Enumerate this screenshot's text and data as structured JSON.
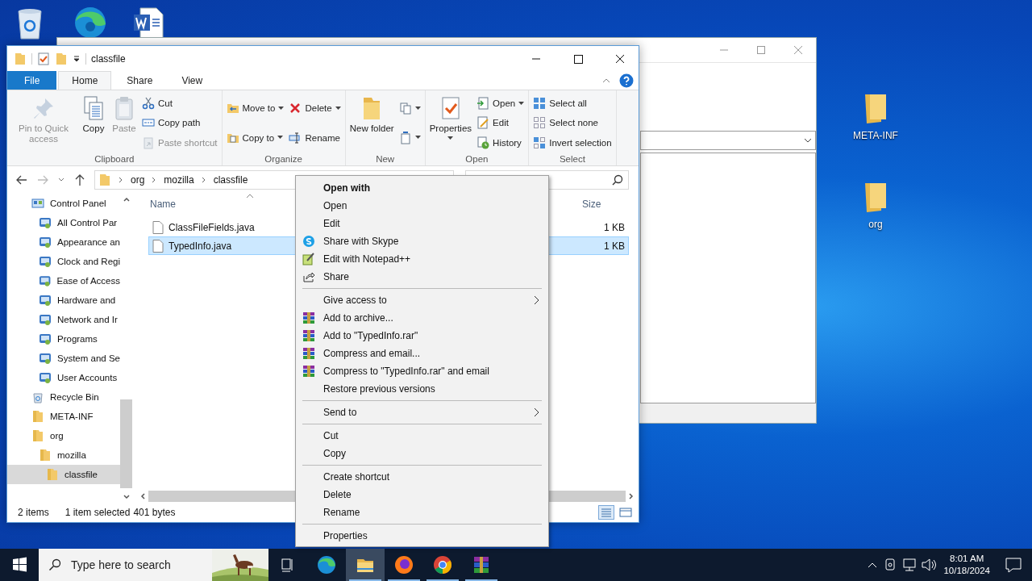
{
  "desktop_shortcuts": [
    {
      "label": "META-INF"
    },
    {
      "label": "org"
    }
  ],
  "explorer": {
    "title": "classfile",
    "tabs": [
      {
        "label": "File",
        "kind": "file",
        "selected": false
      },
      {
        "label": "Home",
        "kind": "tab",
        "selected": true
      },
      {
        "label": "Share",
        "kind": "tab",
        "selected": false
      },
      {
        "label": "View",
        "kind": "tab",
        "selected": false
      }
    ],
    "ribbon": [
      {
        "label": "Clipboard",
        "columns": [
          {
            "kind": "large",
            "items": [
              {
                "label": "Pin to Quick access",
                "disabled": true,
                "dropdown": false
              }
            ]
          },
          {
            "kind": "large",
            "items": [
              {
                "label": "Copy",
                "disabled": false,
                "dropdown": false
              }
            ]
          },
          {
            "kind": "large",
            "items": [
              {
                "label": "Paste",
                "disabled": true,
                "dropdown": false
              }
            ]
          },
          {
            "kind": "small",
            "items": [
              {
                "label": "Cut",
                "disabled": false,
                "dropdown": false
              },
              {
                "label": "Copy path",
                "disabled": false,
                "dropdown": false
              },
              {
                "label": "Paste shortcut",
                "disabled": true,
                "dropdown": false
              }
            ]
          }
        ]
      },
      {
        "label": "Organize",
        "columns": [
          {
            "kind": "small",
            "items": [
              {
                "label": "Move to",
                "disabled": false,
                "dropdown": true
              },
              {
                "label": "Copy to",
                "disabled": false,
                "dropdown": true
              }
            ]
          },
          {
            "kind": "small",
            "items": [
              {
                "label": "Delete",
                "disabled": false,
                "dropdown": true
              },
              {
                "label": "Rename",
                "disabled": false,
                "dropdown": false
              }
            ]
          }
        ]
      },
      {
        "label": "New",
        "columns": [
          {
            "kind": "large",
            "items": [
              {
                "label": "New folder",
                "disabled": false,
                "dropdown": false
              }
            ]
          },
          {
            "kind": "small",
            "items": [
              {
                "disabled": false,
                "dropdown": true
              },
              {
                "disabled": false,
                "dropdown": true
              }
            ]
          }
        ]
      },
      {
        "label": "Open",
        "columns": [
          {
            "kind": "large",
            "items": [
              {
                "label": "Properties",
                "disabled": false,
                "dropdown": true
              }
            ]
          },
          {
            "kind": "small",
            "items": [
              {
                "label": "Open",
                "disabled": false,
                "dropdown": true
              },
              {
                "label": "Edit",
                "disabled": false,
                "dropdown": false
              },
              {
                "label": "History",
                "disabled": false,
                "dropdown": false
              }
            ]
          }
        ]
      },
      {
        "label": "Select",
        "columns": [
          {
            "kind": "small",
            "items": [
              {
                "label": "Select all",
                "disabled": false,
                "dropdown": false
              },
              {
                "label": "Select none",
                "disabled": false,
                "dropdown": false
              },
              {
                "label": "Invert selection",
                "disabled": false,
                "dropdown": false
              }
            ]
          }
        ]
      }
    ],
    "address": {
      "path": [
        "org",
        "mozilla",
        "classfile"
      ]
    },
    "nav": [
      {
        "label": "Control Panel",
        "kind": "control-panel",
        "selected": false,
        "children": [
          {
            "label": "All Control Par",
            "kind": "applet",
            "selected": false
          },
          {
            "label": "Appearance an",
            "kind": "applet",
            "selected": false
          },
          {
            "label": "Clock and Regi",
            "kind": "applet",
            "selected": false
          },
          {
            "label": "Ease of Access",
            "kind": "applet",
            "selected": false
          },
          {
            "label": "Hardware and",
            "kind": "applet",
            "selected": false
          },
          {
            "label": "Network and Ir",
            "kind": "applet",
            "selected": false
          },
          {
            "label": "Programs",
            "kind": "applet",
            "selected": false
          },
          {
            "label": "System and Se",
            "kind": "applet",
            "selected": false
          },
          {
            "label": "User Accounts",
            "kind": "applet",
            "selected": false
          }
        ]
      },
      {
        "label": "Recycle Bin",
        "kind": "recycle-bin",
        "selected": false
      },
      {
        "label": "META-INF",
        "kind": "folder",
        "selected": false
      },
      {
        "label": "org",
        "kind": "folder",
        "selected": false,
        "children": [
          {
            "label": "mozilla",
            "kind": "folder",
            "selected": false,
            "children": [
              {
                "label": "classfile",
                "kind": "folder",
                "selected": true
              }
            ]
          }
        ]
      }
    ],
    "list": {
      "columns": [
        "Name",
        "Size"
      ],
      "files": [
        {
          "name": "ClassFileFields.java",
          "size": "1 KB",
          "selected": false
        },
        {
          "name": "TypedInfo.java",
          "size": "1 KB",
          "selected": true
        }
      ]
    },
    "status": {
      "count": "2 items",
      "selection": "1 item selected",
      "size": "401 bytes",
      "views": [
        {
          "kind": "details",
          "selected": true
        },
        {
          "kind": "icons",
          "selected": false
        }
      ]
    }
  },
  "context_menu": {
    "items": [
      {
        "label": "Open with",
        "kind": "default",
        "submenu": false
      },
      {
        "label": "Open",
        "kind": "item",
        "submenu": false
      },
      {
        "label": "Edit",
        "kind": "item",
        "submenu": false
      },
      {
        "label": "Share with Skype",
        "kind": "item",
        "submenu": false
      },
      {
        "label": "Edit with Notepad++",
        "kind": "item",
        "submenu": false
      },
      {
        "label": "Share",
        "kind": "item",
        "submenu": false
      },
      {
        "kind": "separator"
      },
      {
        "label": "Give access to",
        "kind": "item",
        "submenu": true
      },
      {
        "label": "Add to archive...",
        "kind": "item",
        "submenu": false
      },
      {
        "label": "Add to \"TypedInfo.rar\"",
        "kind": "item",
        "submenu": false
      },
      {
        "label": "Compress and email...",
        "kind": "item",
        "submenu": false
      },
      {
        "label": "Compress to \"TypedInfo.rar\" and email",
        "kind": "item",
        "submenu": false
      },
      {
        "label": "Restore previous versions",
        "kind": "item",
        "submenu": false
      },
      {
        "kind": "separator"
      },
      {
        "label": "Send to",
        "kind": "item",
        "submenu": true
      },
      {
        "kind": "separator"
      },
      {
        "label": "Cut",
        "kind": "item",
        "submenu": false
      },
      {
        "label": "Copy",
        "kind": "item",
        "submenu": false
      },
      {
        "kind": "separator"
      },
      {
        "label": "Create shortcut",
        "kind": "item",
        "submenu": false
      },
      {
        "label": "Delete",
        "kind": "item",
        "submenu": false
      },
      {
        "label": "Rename",
        "kind": "item",
        "submenu": false
      },
      {
        "kind": "separator"
      },
      {
        "label": "Properties",
        "kind": "item",
        "submenu": false
      }
    ]
  },
  "taskbar": {
    "search_placeholder": "Type here to search",
    "apps": [
      {
        "kind": "edge",
        "selected": false,
        "running": false
      },
      {
        "kind": "explorer",
        "selected": true,
        "running": true
      },
      {
        "kind": "firefox",
        "selected": false,
        "running": true
      },
      {
        "kind": "chrome",
        "selected": false,
        "running": true
      },
      {
        "kind": "winrar",
        "selected": false,
        "running": true
      }
    ],
    "time": "8:01 AM",
    "date": "10/18/2024"
  }
}
